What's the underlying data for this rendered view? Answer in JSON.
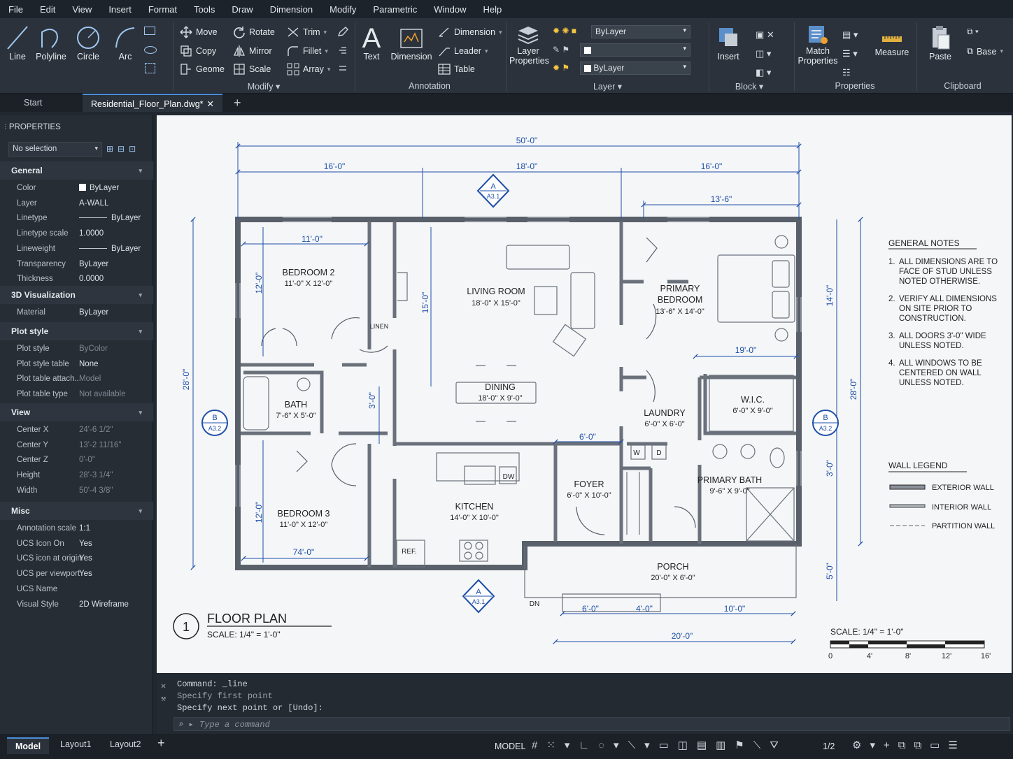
{
  "menu": [
    "File",
    "Edit",
    "View",
    "Insert",
    "Format",
    "Tools",
    "Draw",
    "Dimension",
    "Modify",
    "Parametric",
    "Window",
    "Help"
  ],
  "ribbon": {
    "draw": {
      "line": "Line",
      "polyline": "Polyline",
      "circle": "Circle",
      "arc": "Arc"
    },
    "modify": {
      "move": "Move",
      "rotate": "Rotate",
      "trim": "Trim",
      "copy": "Copy",
      "mirror": "Mirror",
      "fillet": "Fillet",
      "geome": "Geome",
      "scale": "Scale",
      "array": "Array",
      "group": "Modify"
    },
    "annotation": {
      "text": "Text",
      "dimension": "Dimension",
      "dimension_small": "Dimension",
      "leader": "Leader",
      "table": "Table",
      "group": "Annotation"
    },
    "layer": {
      "layer_props": "Layer Properties",
      "dd1": "ByLayer",
      "dd2": "",
      "dd3": "ByLayer",
      "group": "Layer"
    },
    "block": {
      "insert": "Insert",
      "group": "Block"
    },
    "properties": {
      "match": "Match Properties",
      "measure": "Measure",
      "group": "Properties"
    },
    "clipboard": {
      "paste": "Paste",
      "base": "Base",
      "group": "Clipboard"
    }
  },
  "tabs": {
    "start": "Start",
    "file": "Residential_Floor_Plan.dwg*"
  },
  "properties_panel": {
    "title": "PROPERTIES",
    "selection": "No selection",
    "general": {
      "header": "General",
      "rows": [
        [
          "Color",
          "ByLayer"
        ],
        [
          "Layer",
          "A-WALL"
        ],
        [
          "Linetype",
          "ByLayer"
        ],
        [
          "Linetype scale",
          "1.0000"
        ],
        [
          "Lineweight",
          "ByLayer"
        ],
        [
          "Transparency",
          "ByLayer"
        ],
        [
          "Thickness",
          "0.0000"
        ]
      ]
    },
    "viz": {
      "header": "3D Visualization",
      "rows": [
        [
          "Material",
          "ByLayer"
        ]
      ]
    },
    "plot": {
      "header": "Plot style",
      "rows": [
        [
          "Plot style",
          "ByColor"
        ],
        [
          "Plot style table",
          "None"
        ],
        [
          "Plot table attach...",
          "Model"
        ],
        [
          "Plot table type",
          "Not available"
        ]
      ]
    },
    "view": {
      "header": "View",
      "rows": [
        [
          "Center X",
          "24'-6 1/2\""
        ],
        [
          "Center Y",
          "13'-2 11/16\""
        ],
        [
          "Center Z",
          "0'-0\""
        ],
        [
          "Height",
          "28'-3 1/4\""
        ],
        [
          "Width",
          "50'-4 3/8\""
        ]
      ]
    },
    "misc": {
      "header": "Misc",
      "rows": [
        [
          "Annotation scale",
          "1:1"
        ],
        [
          "UCS Icon On",
          "Yes"
        ],
        [
          "UCS icon at origin",
          "Yes"
        ],
        [
          "UCS per viewport",
          "Yes"
        ],
        [
          "UCS Name",
          ""
        ],
        [
          "Visual Style",
          "2D Wireframe"
        ]
      ]
    }
  },
  "plan": {
    "dims": {
      "overall": "50'-0\"",
      "d16a": "16'-0\"",
      "d18": "18'-0\"",
      "d16b": "16'-0\"",
      "d13_6": "13'-6\"",
      "d11": "11'-0\"",
      "d12a": "12'-0\"",
      "d15": "15'-0\"",
      "d28l": "28'-0\"",
      "d14": "14'-0\"",
      "d19": "19'-0\"",
      "d28r": "28'-0\"",
      "d3": "3'-0\"",
      "d3b": "3'-0\"",
      "d6": "6'-0\"",
      "d12b": "12'-0\"",
      "d74": "74'-0\"",
      "d5": "5'-0\"",
      "d6b": "6'-0\"",
      "d4": "4'-0\"",
      "d10": "10'-0\"",
      "d20": "20'-0\""
    },
    "rooms": {
      "bed2": [
        "BEDROOM 2",
        "11'-0\" X 12'-0\""
      ],
      "living": [
        "LIVING ROOM",
        "18'-0\" X 15'-0\""
      ],
      "primary": [
        "PRIMARY",
        "BEDROOM",
        "13'-6\" X 14'-0\""
      ],
      "dining": [
        "DINING",
        "18'-0\" X 9'-0\""
      ],
      "bath": [
        "BATH",
        "7'-6\" X 5'-0\""
      ],
      "laundry": [
        "LAUNDRY",
        "6'-0\" X 6'-0\""
      ],
      "wic": [
        "W.I.C.",
        "6'-0\" X 9'-0\""
      ],
      "bed3": [
        "BEDROOM 3",
        "11'-0\" X 12'-0\""
      ],
      "kitchen": [
        "KITCHEN",
        "14'-0\" X 10'-0\""
      ],
      "foyer": [
        "FOYER",
        "6'-0\" X 10'-0\""
      ],
      "pbath": [
        "PRIMARY BATH",
        "9'-6\" X 9'-0\""
      ],
      "porch": [
        "PORCH",
        "20'-0\" X 6'-0\""
      ]
    },
    "labels": {
      "linen": "LINEN",
      "dw": "DW",
      "ref": "REF.",
      "w": "W",
      "d": "D",
      "dn": "DN"
    },
    "markers": {
      "top": [
        "A",
        "A3.1"
      ],
      "left": [
        "B",
        "A3.2"
      ],
      "right": [
        "B",
        "A3.2"
      ],
      "bottom": [
        "A",
        "A3.1"
      ]
    },
    "title": {
      "num": "1",
      "name": "FLOOR PLAN",
      "scale": "SCALE: 1/4\" = 1'-0\""
    },
    "notes": {
      "header": "GENERAL NOTES",
      "items": [
        [
          "1.",
          "ALL DIMENSIONS ARE TO",
          "FACE OF STUD UNLESS",
          "NOTED OTHERWISE."
        ],
        [
          "2.",
          "VERIFY ALL DIMENSIONS",
          "ON SITE PRIOR TO",
          "CONSTRUCTION."
        ],
        [
          "3.",
          "ALL DOORS 3'-0\" WIDE",
          "UNLESS NOTED."
        ],
        [
          "4.",
          "ALL WINDOWS TO BE",
          "CENTERED ON WALL",
          "UNLESS NOTED."
        ]
      ]
    },
    "legend": {
      "header": "WALL LEGEND",
      "items": [
        "EXTERIOR WALL",
        "INTERIOR WALL",
        "PARTITION WALL"
      ]
    },
    "scalebar": {
      "label": "SCALE: 1/4\" = 1'-0\"",
      "ticks": [
        "0",
        "4'",
        "8'",
        "12'",
        "16'"
      ]
    }
  },
  "command": {
    "line1": "Command: _line",
    "line2": "Specify first point",
    "line3": "Specify next point or [Undo]:",
    "placeholder": "Type a command"
  },
  "layouts": {
    "model": "Model",
    "l1": "Layout1",
    "l2": "Layout2"
  },
  "status": {
    "model": "MODEL",
    "scale": "1/2"
  },
  "colors": {
    "accent": "#4a8fd8",
    "dim": "#1f4fa8",
    "wall": "#59606a"
  }
}
